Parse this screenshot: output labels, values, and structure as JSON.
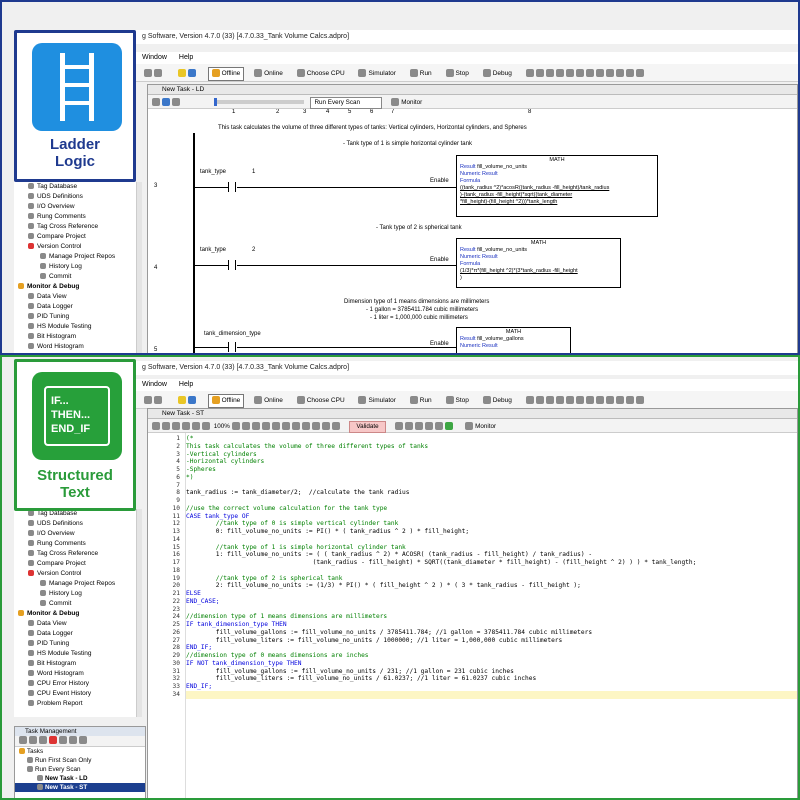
{
  "colors": {
    "top_border": "#1f3a8f",
    "bottom_border": "#2a9b3a",
    "ladder_badge": "#1f8fe0",
    "st_badge": "#27a03a"
  },
  "window": {
    "title": "g Software, Version 4.7.0 (33)   [4.7.0.33_Tank Volume Calcs.adpro]"
  },
  "menu": [
    "Window",
    "Help"
  ],
  "toolbar": {
    "offline": "Offline",
    "online": "Online",
    "choose_cpu": "Choose CPU",
    "simulator": "Simulator",
    "run": "Run",
    "stop": "Stop",
    "debug": "Debug"
  },
  "badges": {
    "ladder_line1": "Ladder",
    "ladder_line2": "Logic",
    "st_icon_l1": "IF...",
    "st_icon_l2": "THEN...",
    "st_icon_l3": "END_IF",
    "st_line1": "Structured",
    "st_line2": "Text"
  },
  "tree_top": [
    "Tag Database",
    "UDS Definitions",
    "I/O Overview",
    "Rung Comments",
    "Tag Cross Reference",
    "Compare Project",
    "Version Control",
    "Manage Project Repos",
    "History Log",
    "Commit",
    "Monitor & Debug",
    "Data View",
    "Data Logger",
    "PID Tuning",
    "HS Module Testing",
    "Bit Histogram",
    "Word Histogram"
  ],
  "tree_bot": [
    "Tag Database",
    "UDS Definitions",
    "I/O Overview",
    "Rung Comments",
    "Tag Cross Reference",
    "Compare Project",
    "Version Control",
    "Manage Project Repos",
    "History Log",
    "Commit",
    "Monitor & Debug",
    "Data View",
    "Data Logger",
    "PID Tuning",
    "HS Module Testing",
    "Bit Histogram",
    "Word Histogram",
    "CPU Error History",
    "CPU Event History",
    "Problem Report"
  ],
  "ld": {
    "doc_title": "New Task - LD",
    "run_mode": "Run Every Scan",
    "monitor": "Monitor",
    "cols": [
      "1",
      "2",
      "3",
      "4",
      "5",
      "6",
      "7",
      "8"
    ],
    "header_comment": "This task calculates the volume of three different types of tanks: Vertical cylinders, Horizontal cylinders, and Spheres",
    "rung3": {
      "num": "3",
      "comment": "- Tank type of 1 is simple horizontal cylinder tank",
      "tag": "tank_type",
      "val": "1",
      "enable": "Enable",
      "math": "MATH",
      "result": "Result",
      "result_tag": "fill_volume_no_units",
      "numeric": "Numeric Result",
      "formula": "Formula",
      "f1": "((tank_radius ^2)*acosR((tank_radius -fill_height)/tank_radius",
      "f2": ")-(tank_radius -fill_height)*sqrt((tank_diameter",
      "f3": "*fill_height)-(fill_height ^2)))*tank_length"
    },
    "rung4": {
      "num": "4",
      "comment": "- Tank type of 2 is spherical tank",
      "tag": "tank_type",
      "val": "2",
      "enable": "Enable",
      "math": "MATH",
      "result": "Result",
      "result_tag": "fill_volume_no_units",
      "numeric": "Numeric Result",
      "formula": "Formula",
      "f1": "(1/3)*π*(fill_height ^2)*(3*tank_radius -fill_height",
      "f2": ")"
    },
    "rung5": {
      "num": "5",
      "c1": "Dimension type of 1 means dimensions are millimeters",
      "c2": "- 1 gallon = 3785411.784 cubic millimeters",
      "c3": "- 1 liter = 1,000,000 cubic millimeters",
      "tag": "tank_dimension_type",
      "enable": "Enable",
      "math": "MATH",
      "result": "Result",
      "result_tag": "fill_volume_gallons",
      "numeric": "Numeric Result"
    }
  },
  "st": {
    "doc_title": "New Task - ST",
    "zoom": "100%",
    "validate": "Validate",
    "monitor": "Monitor",
    "lines": [
      {
        "n": "1",
        "t": "(*",
        "s": "c"
      },
      {
        "n": "2",
        "t": "This task calculates the volume of three different types of tanks",
        "s": "c"
      },
      {
        "n": "3",
        "t": "-Vertical cylinders",
        "s": "c"
      },
      {
        "n": "4",
        "t": "-Horizontal cylinders",
        "s": "c"
      },
      {
        "n": "5",
        "t": "-Spheres",
        "s": "c"
      },
      {
        "n": "6",
        "t": "*)",
        "s": "c"
      },
      {
        "n": "7",
        "t": "",
        "s": "n"
      },
      {
        "n": "8",
        "t": "tank_radius := tank_diameter/2;  //calculate the tank radius",
        "s": "n"
      },
      {
        "n": "9",
        "t": "",
        "s": "n"
      },
      {
        "n": "10",
        "t": "//use the correct volume calculation for the tank type",
        "s": "c"
      },
      {
        "n": "11",
        "t": "CASE tank_type OF",
        "s": "k"
      },
      {
        "n": "12",
        "t": "        //tank type of 0 is simple vertical cylinder tank",
        "s": "c"
      },
      {
        "n": "13",
        "t": "        0: fill_volume_no_units := PI() * ( tank_radius ^ 2 ) * fill_height;",
        "s": "n"
      },
      {
        "n": "14",
        "t": "",
        "s": "n"
      },
      {
        "n": "15",
        "t": "        //tank type of 1 is simple horizontal cylinder tank",
        "s": "c"
      },
      {
        "n": "16",
        "t": "        1: fill_volume_no_units := ( ( tank_radius ^ 2) * ACOSR( (tank_radius - fill_height) / tank_radius) -",
        "s": "n"
      },
      {
        "n": "17",
        "t": "                                  (tank_radius - fill_height) * SQRT((tank_diameter * fill_height) - (fill_height ^ 2) ) ) * tank_length;",
        "s": "n"
      },
      {
        "n": "18",
        "t": "",
        "s": "n"
      },
      {
        "n": "19",
        "t": "        //tank type of 2 is spherical tank",
        "s": "c"
      },
      {
        "n": "20",
        "t": "        2: fill_volume_no_units := (1/3) * PI() * ( fill_height ^ 2 ) * ( 3 * tank_radius - fill_height );",
        "s": "n"
      },
      {
        "n": "21",
        "t": "ELSE",
        "s": "k"
      },
      {
        "n": "22",
        "t": "END_CASE;",
        "s": "k"
      },
      {
        "n": "23",
        "t": "",
        "s": "n"
      },
      {
        "n": "24",
        "t": "//dimension type of 1 means dimensions are millimeters",
        "s": "c"
      },
      {
        "n": "25",
        "t": "IF tank_dimension_type THEN",
        "s": "k"
      },
      {
        "n": "26",
        "t": "        fill_volume_gallons := fill_volume_no_units / 3785411.784; //1 gallon = 3785411.784 cubic millimeters",
        "s": "n"
      },
      {
        "n": "27",
        "t": "        fill_volume_liters := fill_volume_no_units / 1000000; //1 liter = 1,000,000 cubic millimeters",
        "s": "n"
      },
      {
        "n": "28",
        "t": "END_IF;",
        "s": "k"
      },
      {
        "n": "29",
        "t": "//dimension type of 0 means dimensions are inches",
        "s": "c"
      },
      {
        "n": "30",
        "t": "IF NOT tank_dimension_type THEN",
        "s": "k"
      },
      {
        "n": "31",
        "t": "        fill_volume_gallons := fill_volume_no_units / 231; //1 gallon = 231 cubic inches",
        "s": "n"
      },
      {
        "n": "32",
        "t": "        fill_volume_liters := fill_volume_no_units / 61.0237; //1 liter = 61.0237 cubic inches",
        "s": "n"
      },
      {
        "n": "33",
        "t": "END_IF;",
        "s": "k"
      },
      {
        "n": "34",
        "t": "",
        "s": "n"
      }
    ]
  },
  "task_mgmt": {
    "title": "Task Management",
    "items": [
      "Tasks",
      "Run First Scan Only",
      "Run Every Scan",
      "New Task - LD",
      "New Task - ST"
    ]
  }
}
